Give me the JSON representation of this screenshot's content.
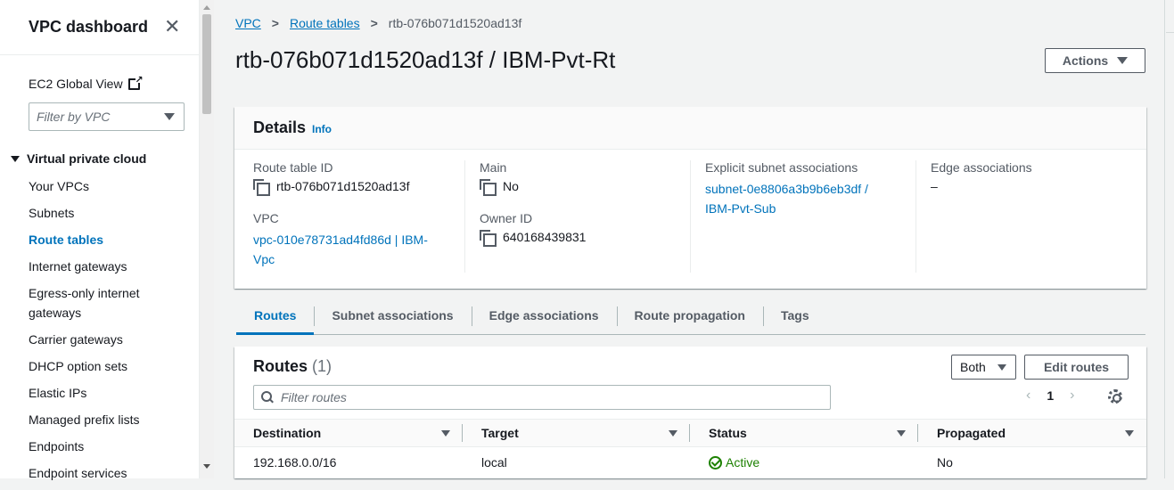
{
  "sidebar": {
    "title": "VPC dashboard",
    "close_glyph": "✕",
    "global_view": "EC2 Global View",
    "filter_placeholder": "Filter by VPC",
    "section": "Virtual private cloud",
    "items": [
      {
        "label": "Your VPCs"
      },
      {
        "label": "Subnets"
      },
      {
        "label": "Route tables"
      },
      {
        "label": "Internet gateways"
      },
      {
        "label": "Egress-only internet gateways"
      },
      {
        "label": "Carrier gateways"
      },
      {
        "label": "DHCP option sets"
      },
      {
        "label": "Elastic IPs"
      },
      {
        "label": "Managed prefix lists"
      },
      {
        "label": "Endpoints"
      },
      {
        "label": "Endpoint services"
      }
    ],
    "active_item": "Route tables"
  },
  "breadcrumb": [
    "VPC",
    "Route tables",
    "rtb-076b071d1520ad13f"
  ],
  "page_title": "rtb-076b071d1520ad13f / IBM-Pvt-Rt",
  "actions_label": "Actions",
  "details": {
    "title": "Details",
    "info": "Info",
    "route_table_id_label": "Route table ID",
    "route_table_id": "rtb-076b071d1520ad13f",
    "vpc_label": "VPC",
    "vpc_line1": "vpc-010e78731ad4fd86d | IBM-",
    "vpc_line2": "Vpc",
    "main_label": "Main",
    "main_value": "No",
    "owner_label": "Owner ID",
    "owner_value": "640168439831",
    "explicit_label": "Explicit subnet associations",
    "explicit_line1": "subnet-0e8806a3b9b6eb3df /",
    "explicit_line2": "IBM-Pvt-Sub",
    "edge_label": "Edge associations",
    "edge_value": "–"
  },
  "tabs": [
    "Routes",
    "Subnet associations",
    "Edge associations",
    "Route propagation",
    "Tags"
  ],
  "routes": {
    "title": "Routes",
    "count": "(1)",
    "both_label": "Both",
    "edit_label": "Edit routes",
    "filter_placeholder": "Filter routes",
    "page": "1",
    "prev": "‹",
    "next": "›",
    "columns": [
      "Destination",
      "Target",
      "Status",
      "Propagated"
    ],
    "rows": [
      {
        "destination": "192.168.0.0/16",
        "target": "local",
        "status": "Active",
        "propagated": "No"
      }
    ]
  },
  "colors": {
    "link": "#0073bb",
    "success": "#1d8102",
    "text": "#16191f",
    "muted": "#545b64"
  }
}
